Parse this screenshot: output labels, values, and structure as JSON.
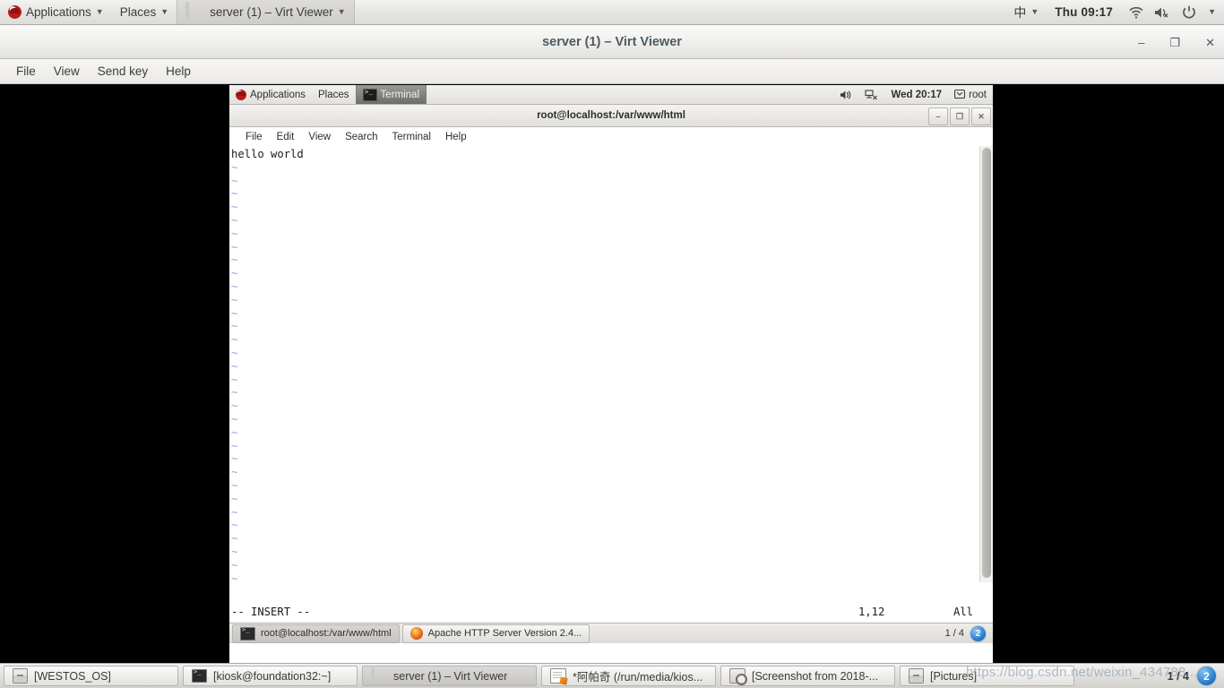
{
  "host_top_panel": {
    "applications": "Applications",
    "places": "Places",
    "active_window": "server (1) – Virt Viewer",
    "input_method": "中",
    "clock": "Thu 09:17",
    "icons": [
      "wifi-icon",
      "volume-muted-icon",
      "power-icon",
      "chevron-down-icon"
    ]
  },
  "virt_viewer": {
    "title": "server (1) – Virt Viewer",
    "menus": [
      "File",
      "View",
      "Send key",
      "Help"
    ],
    "window_buttons": {
      "minimize": "–",
      "maximize": "❐",
      "close": "✕"
    }
  },
  "guest": {
    "top_panel": {
      "applications": "Applications",
      "places": "Places",
      "active_window": "Terminal",
      "clock": "Wed 20:17",
      "user": "root"
    },
    "terminal": {
      "title": "root@localhost:/var/www/html",
      "menus": [
        "File",
        "Edit",
        "View",
        "Search",
        "Terminal",
        "Help"
      ],
      "window_buttons": {
        "minimize": "–",
        "maximize": "❐",
        "close": "✕"
      },
      "content_line": "hello world",
      "tilde_count": 35,
      "status": {
        "mode": "-- INSERT --",
        "position": "1,12",
        "percent": "All"
      }
    },
    "taskbar": {
      "items": [
        {
          "label": "root@localhost:/var/www/html",
          "icon": "terminal-icon",
          "selected": true
        },
        {
          "label": "Apache HTTP Server Version 2.4...",
          "icon": "firefox-icon",
          "selected": false
        }
      ],
      "workspace": "1 / 4",
      "workspace_badge": "2"
    }
  },
  "host_taskbar": {
    "items": [
      {
        "label": "[WESTOS_OS]",
        "icon": "archive-icon",
        "selected": false
      },
      {
        "label": "[kiosk@foundation32:~]",
        "icon": "terminal-icon",
        "selected": false
      },
      {
        "label": "server (1) – Virt Viewer",
        "icon": "monitor-icon",
        "selected": true
      },
      {
        "label": "*阿帕奇 (/run/media/kios...",
        "icon": "notepad-icon",
        "selected": false
      },
      {
        "label": "[Screenshot from 2018-...",
        "icon": "screenshot-icon",
        "selected": false
      },
      {
        "label": "[Pictures]",
        "icon": "archive-icon",
        "selected": false
      }
    ],
    "workspace": "1 / 4",
    "workspace_badge": "2"
  },
  "watermark": {
    "text": "https://blog.csdn.net/weixin_434788..."
  },
  "colors": {
    "panel_bg": "#e6e5e2",
    "accent_blue": "#2a7fd0",
    "terminal_bg": "#ffffff",
    "tilde_blue": "#8fa7d8",
    "canvas_black": "#000000"
  }
}
